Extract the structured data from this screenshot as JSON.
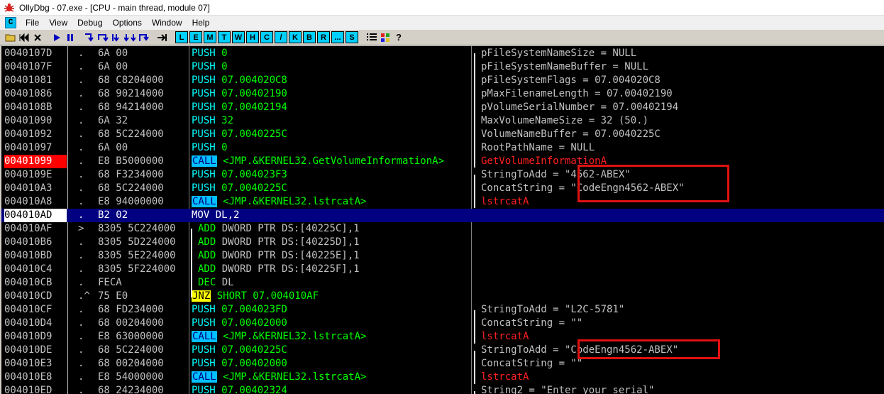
{
  "window": {
    "title": "OllyDbg - 07.exe - [CPU - main thread, module 07]"
  },
  "menu": [
    "File",
    "View",
    "Debug",
    "Options",
    "Window",
    "Help"
  ],
  "toolbar": {
    "letters": [
      "L",
      "E",
      "M",
      "T",
      "W",
      "H",
      "C",
      "/",
      "K",
      "B",
      "R",
      "...",
      "S"
    ]
  },
  "rows": [
    {
      "addr": "0040107D",
      "flag": ".",
      "hex": "6A 00",
      "mnem": "PUSH",
      "operand": " 0",
      "comment": "pFileSystemNameSize = NULL",
      "comment_red": false
    },
    {
      "addr": "0040107F",
      "flag": ".",
      "hex": "6A 00",
      "mnem": "PUSH",
      "operand": " 0",
      "comment": "pFileSystemNameBuffer = NULL",
      "comment_red": false
    },
    {
      "addr": "00401081",
      "flag": ".",
      "hex": "68 C8204000",
      "mnem": "PUSH",
      "operand": " 07.004020C8",
      "comment": "pFileSystemFlags = 07.004020C8",
      "comment_red": false
    },
    {
      "addr": "00401086",
      "flag": ".",
      "hex": "68 90214000",
      "mnem": "PUSH",
      "operand": " 07.00402190",
      "comment": "pMaxFilenameLength = 07.00402190",
      "comment_red": false
    },
    {
      "addr": "0040108B",
      "flag": ".",
      "hex": "68 94214000",
      "mnem": "PUSH",
      "operand": " 07.00402194",
      "comment": "pVolumeSerialNumber = 07.00402194",
      "comment_red": false
    },
    {
      "addr": "00401090",
      "flag": ".",
      "hex": "6A 32",
      "mnem": "PUSH",
      "operand": " 32",
      "comment": "MaxVolumeNameSize = 32 (50.)",
      "comment_red": false
    },
    {
      "addr": "00401092",
      "flag": ".",
      "hex": "68 5C224000",
      "mnem": "PUSH",
      "operand": " 07.0040225C",
      "comment": "VolumeNameBuffer = 07.0040225C",
      "comment_red": false
    },
    {
      "addr": "00401097",
      "flag": ".",
      "hex": "6A 00",
      "mnem": "PUSH",
      "operand": " 0",
      "comment": "RootPathName = NULL",
      "comment_red": false
    },
    {
      "addr": "00401099",
      "flag": ".",
      "hex": "E8 B5000000",
      "mnem": "CALL",
      "operand": " <JMP.&KERNEL32.GetVolumeInformationA>",
      "comment": "GetVolumeInformationA",
      "comment_red": true
    },
    {
      "addr": "0040109E",
      "flag": ".",
      "hex": "68 F3234000",
      "mnem": "PUSH",
      "operand": " 07.004023F3",
      "comment": "StringToAdd = \"4562-ABEX\"",
      "comment_red": false
    },
    {
      "addr": "004010A3",
      "flag": ".",
      "hex": "68 5C224000",
      "mnem": "PUSH",
      "operand": " 07.0040225C",
      "comment": "ConcatString = \"CodeEngn4562-ABEX\"",
      "comment_red": false
    },
    {
      "addr": "004010A8",
      "flag": ".",
      "hex": "E8 94000000",
      "mnem": "CALL",
      "operand": " <JMP.&KERNEL32.lstrcatA>",
      "comment": "lstrcatA",
      "comment_red": true
    },
    {
      "addr": "004010AD",
      "flag": ".",
      "hex": "B2 02",
      "mnem": "MOV",
      "operand": " DL,2",
      "comment": "",
      "comment_red": false
    },
    {
      "addr": "004010AF",
      "flag": ">",
      "hex": "8305 5C224000",
      "mnem": "ADD",
      "operand": " DWORD PTR DS:[40225C],1",
      "comment": "",
      "comment_red": false
    },
    {
      "addr": "004010B6",
      "flag": ".",
      "hex": "8305 5D224000",
      "mnem": "ADD",
      "operand": " DWORD PTR DS:[40225D],1",
      "comment": "",
      "comment_red": false
    },
    {
      "addr": "004010BD",
      "flag": ".",
      "hex": "8305 5E224000",
      "mnem": "ADD",
      "operand": " DWORD PTR DS:[40225E],1",
      "comment": "",
      "comment_red": false
    },
    {
      "addr": "004010C4",
      "flag": ".",
      "hex": "8305 5F224000",
      "mnem": "ADD",
      "operand": " DWORD PTR DS:[40225F],1",
      "comment": "",
      "comment_red": false
    },
    {
      "addr": "004010CB",
      "flag": ".",
      "hex": "FECA",
      "mnem": "DEC",
      "operand": " DL",
      "comment": "",
      "comment_red": false
    },
    {
      "addr": "004010CD",
      "flag": ".^",
      "hex": "75 E0",
      "mnem": "JNZ",
      "operand": " SHORT 07.004010AF",
      "comment": "",
      "comment_red": false
    },
    {
      "addr": "004010CF",
      "flag": ".",
      "hex": "68 FD234000",
      "mnem": "PUSH",
      "operand": " 07.004023FD",
      "comment": "StringToAdd = \"L2C-5781\"",
      "comment_red": false
    },
    {
      "addr": "004010D4",
      "flag": ".",
      "hex": "68 00204000",
      "mnem": "PUSH",
      "operand": " 07.00402000",
      "comment": "ConcatString = \"\"",
      "comment_red": false
    },
    {
      "addr": "004010D9",
      "flag": ".",
      "hex": "E8 63000000",
      "mnem": "CALL",
      "operand": " <JMP.&KERNEL32.lstrcatA>",
      "comment": "lstrcatA",
      "comment_red": true
    },
    {
      "addr": "004010DE",
      "flag": ".",
      "hex": "68 5C224000",
      "mnem": "PUSH",
      "operand": " 07.0040225C",
      "comment": "StringToAdd = \"CodeEngn4562-ABEX\"",
      "comment_red": false
    },
    {
      "addr": "004010E3",
      "flag": ".",
      "hex": "68 00204000",
      "mnem": "PUSH",
      "operand": " 07.00402000",
      "comment": "ConcatString = \"\"",
      "comment_red": false
    },
    {
      "addr": "004010E8",
      "flag": ".",
      "hex": "E8 54000000",
      "mnem": "CALL",
      "operand": " <JMP.&KERNEL32.lstrcatA>",
      "comment": "lstrcatA",
      "comment_red": true
    },
    {
      "addr": "004010ED",
      "flag": ".",
      "hex": "68 24234000",
      "mnem": "PUSH",
      "operand": " 07.00402324",
      "comment": "String2 = \"Enter your serial\"",
      "comment_red": false
    }
  ],
  "breakpoint_row": 8,
  "selected_row": 12
}
